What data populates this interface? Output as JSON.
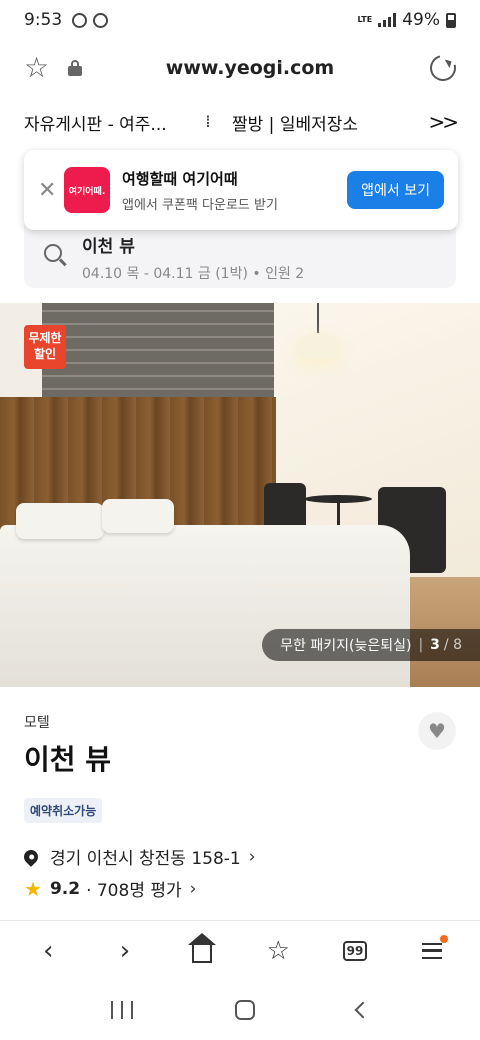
{
  "status_bar": {
    "time": "9:53",
    "network": "LTE",
    "battery": "49%"
  },
  "browser": {
    "url": "www.yeogi.com",
    "tabs": [
      "자유게시판 - 여주...",
      "짤방 | 일베저장소"
    ],
    "more_tabs_glyph": ">>",
    "tab_count": "99"
  },
  "app_banner": {
    "logo_text": "여기어때.",
    "title": "여행할때 여기어때",
    "subtitle": "앱에서 쿠폰팩 다운로드 받기",
    "button_label": "앱에서 보기"
  },
  "search": {
    "query": "이천 뷰",
    "details": "04.10 목 - 04.11 금 (1박) • 인원 2"
  },
  "gallery": {
    "badge": "무제한 할인",
    "package_label": "무한 패키지(늦은퇴실)",
    "current": "3",
    "total": "/ 8"
  },
  "property": {
    "category": "모텔",
    "name": "이천 뷰",
    "tag": "예약취소가능",
    "address": "경기 이천시 창전동 158-1",
    "rating": "9.2",
    "reviews": "· 708명 평가"
  },
  "colors": {
    "brand_red": "#ee1c4c",
    "button_blue": "#1a7fe6",
    "badge_red": "#e8452c",
    "rating_star": "#f6b700"
  }
}
